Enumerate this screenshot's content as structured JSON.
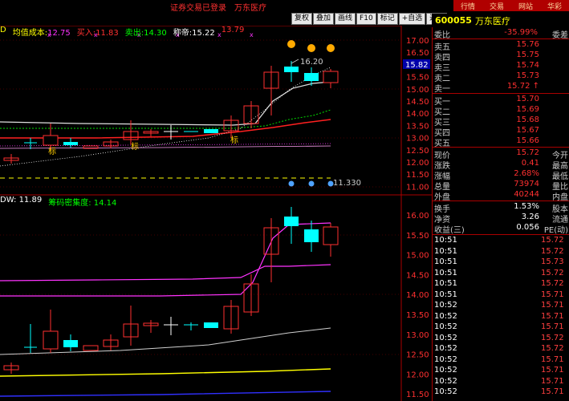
{
  "top": {
    "broker_text": "证券交易已登录　万东医疗",
    "menu": [
      "行情",
      "交易",
      "网站",
      "华彩"
    ]
  },
  "toolbar": {
    "buttons": [
      "复权",
      "叠加",
      "画线",
      "F10",
      "标记",
      "+自选",
      "返回"
    ]
  },
  "stock": {
    "code": "600055",
    "name": "万东医疗"
  },
  "price_panel": {
    "prefix": "D",
    "avg_cost_label": "均值成本:",
    "avg_cost": "12.75",
    "buy_label": "买入:",
    "buy": "11.83",
    "sell_label": "卖出:",
    "sell": "14.30",
    "mark_label": "称帝:",
    "mark": "15.22",
    "extra": "13.79"
  },
  "volume_panel": {
    "prefix": "DW:",
    "value": "11.89",
    "density_label": "筹码密集度:",
    "density": "14.14"
  },
  "price_axis": [
    "17.00",
    "16.50",
    "16.00",
    "15.50",
    "15.00",
    "14.50",
    "14.00",
    "13.50",
    "13.00",
    "12.50",
    "12.00",
    "11.50",
    "11.00"
  ],
  "price_axis_highlight": "15.82",
  "lower_axis": [
    "16.00",
    "15.50",
    "15.00",
    "14.50",
    "14.00",
    "13.50",
    "13.00",
    "12.50",
    "12.00",
    "11.50"
  ],
  "annotations": {
    "high_label": "16.20",
    "low_label": "11.330",
    "mark_tags": [
      "标",
      "标",
      "标"
    ]
  },
  "quote": {
    "ratio_label": "委比",
    "ratio": "-35.99%",
    "diff_label": "委差",
    "asks": [
      {
        "label": "卖五",
        "price": "15.76"
      },
      {
        "label": "卖四",
        "price": "15.75"
      },
      {
        "label": "卖三",
        "price": "15.74"
      },
      {
        "label": "卖二",
        "price": "15.73"
      },
      {
        "label": "卖一",
        "price": "15.72 ↑"
      }
    ],
    "bids": [
      {
        "label": "买一",
        "price": "15.70"
      },
      {
        "label": "买二",
        "price": "15.69"
      },
      {
        "label": "买三",
        "price": "15.68"
      },
      {
        "label": "买四",
        "price": "15.67"
      },
      {
        "label": "买五",
        "price": "15.66"
      }
    ],
    "stats": [
      {
        "l1": "现价",
        "v1": "15.72",
        "l2": "今开"
      },
      {
        "l1": "涨跌",
        "v1": "0.41",
        "l2": "最高"
      },
      {
        "l1": "涨幅",
        "v1": "2.68%",
        "l2": "最低"
      },
      {
        "l1": "总量",
        "v1": "73974",
        "l2": "量比"
      },
      {
        "l1": "外盘",
        "v1": "40244",
        "l2": "内盘"
      }
    ],
    "stats2": [
      {
        "l1": "换手",
        "v1": "1.53%",
        "l2": "股本"
      },
      {
        "l1": "净资",
        "v1": "3.26",
        "l2": "流通"
      },
      {
        "l1": "收益(三)",
        "v1": "0.056",
        "l2": "PE(动)"
      }
    ],
    "ticks": [
      {
        "time": "10:51",
        "price": "15.72"
      },
      {
        "time": "10:51",
        "price": "15.72"
      },
      {
        "time": "10:51",
        "price": "15.73"
      },
      {
        "time": "10:51",
        "price": "15.72"
      },
      {
        "time": "10:51",
        "price": "15.72"
      },
      {
        "time": "10:51",
        "price": "15.71"
      },
      {
        "time": "10:52",
        "price": "15.71"
      },
      {
        "time": "10:52",
        "price": "15.71"
      },
      {
        "time": "10:52",
        "price": "15.71"
      },
      {
        "time": "10:52",
        "price": "15.72"
      },
      {
        "time": "10:52",
        "price": "15.72"
      },
      {
        "time": "10:52",
        "price": "15.71"
      },
      {
        "time": "10:52",
        "price": "15.71"
      },
      {
        "time": "10:52",
        "price": "15.71"
      },
      {
        "time": "10:52",
        "price": "15.71"
      }
    ]
  },
  "colors": {
    "up": "#ff3030",
    "down": "#00ffff",
    "ma_white": "#ffffff",
    "ma_magenta": "#ff33ff",
    "ma_yellow": "#ffff00"
  }
}
